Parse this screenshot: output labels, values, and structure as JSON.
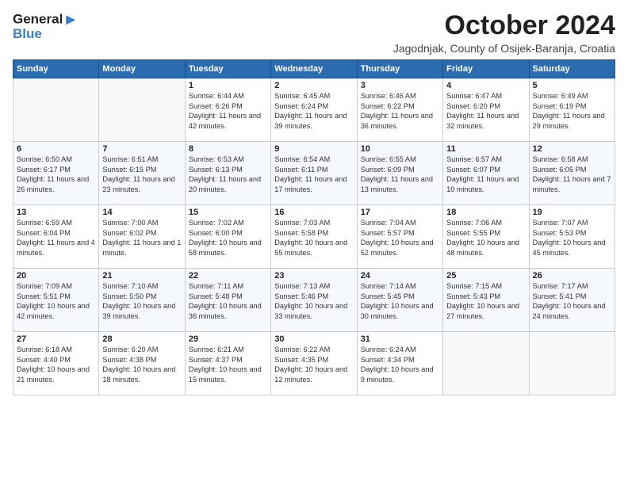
{
  "header": {
    "logo_line1": "General",
    "logo_line2": "Blue",
    "month": "October 2024",
    "location": "Jagodnjak, County of Osijek-Baranja, Croatia"
  },
  "weekdays": [
    "Sunday",
    "Monday",
    "Tuesday",
    "Wednesday",
    "Thursday",
    "Friday",
    "Saturday"
  ],
  "weeks": [
    [
      {
        "day": "",
        "info": ""
      },
      {
        "day": "",
        "info": ""
      },
      {
        "day": "1",
        "info": "Sunrise: 6:44 AM\nSunset: 6:26 PM\nDaylight: 11 hours and 42 minutes."
      },
      {
        "day": "2",
        "info": "Sunrise: 6:45 AM\nSunset: 6:24 PM\nDaylight: 11 hours and 39 minutes."
      },
      {
        "day": "3",
        "info": "Sunrise: 6:46 AM\nSunset: 6:22 PM\nDaylight: 11 hours and 36 minutes."
      },
      {
        "day": "4",
        "info": "Sunrise: 6:47 AM\nSunset: 6:20 PM\nDaylight: 11 hours and 32 minutes."
      },
      {
        "day": "5",
        "info": "Sunrise: 6:49 AM\nSunset: 6:19 PM\nDaylight: 11 hours and 29 minutes."
      }
    ],
    [
      {
        "day": "6",
        "info": "Sunrise: 6:50 AM\nSunset: 6:17 PM\nDaylight: 11 hours and 26 minutes."
      },
      {
        "day": "7",
        "info": "Sunrise: 6:51 AM\nSunset: 6:15 PM\nDaylight: 11 hours and 23 minutes."
      },
      {
        "day": "8",
        "info": "Sunrise: 6:53 AM\nSunset: 6:13 PM\nDaylight: 11 hours and 20 minutes."
      },
      {
        "day": "9",
        "info": "Sunrise: 6:54 AM\nSunset: 6:11 PM\nDaylight: 11 hours and 17 minutes."
      },
      {
        "day": "10",
        "info": "Sunrise: 6:55 AM\nSunset: 6:09 PM\nDaylight: 11 hours and 13 minutes."
      },
      {
        "day": "11",
        "info": "Sunrise: 6:57 AM\nSunset: 6:07 PM\nDaylight: 11 hours and 10 minutes."
      },
      {
        "day": "12",
        "info": "Sunrise: 6:58 AM\nSunset: 6:05 PM\nDaylight: 11 hours and 7 minutes."
      }
    ],
    [
      {
        "day": "13",
        "info": "Sunrise: 6:59 AM\nSunset: 6:04 PM\nDaylight: 11 hours and 4 minutes."
      },
      {
        "day": "14",
        "info": "Sunrise: 7:00 AM\nSunset: 6:02 PM\nDaylight: 11 hours and 1 minute."
      },
      {
        "day": "15",
        "info": "Sunrise: 7:02 AM\nSunset: 6:00 PM\nDaylight: 10 hours and 58 minutes."
      },
      {
        "day": "16",
        "info": "Sunrise: 7:03 AM\nSunset: 5:58 PM\nDaylight: 10 hours and 55 minutes."
      },
      {
        "day": "17",
        "info": "Sunrise: 7:04 AM\nSunset: 5:57 PM\nDaylight: 10 hours and 52 minutes."
      },
      {
        "day": "18",
        "info": "Sunrise: 7:06 AM\nSunset: 5:55 PM\nDaylight: 10 hours and 48 minutes."
      },
      {
        "day": "19",
        "info": "Sunrise: 7:07 AM\nSunset: 5:53 PM\nDaylight: 10 hours and 45 minutes."
      }
    ],
    [
      {
        "day": "20",
        "info": "Sunrise: 7:09 AM\nSunset: 5:51 PM\nDaylight: 10 hours and 42 minutes."
      },
      {
        "day": "21",
        "info": "Sunrise: 7:10 AM\nSunset: 5:50 PM\nDaylight: 10 hours and 39 minutes."
      },
      {
        "day": "22",
        "info": "Sunrise: 7:11 AM\nSunset: 5:48 PM\nDaylight: 10 hours and 36 minutes."
      },
      {
        "day": "23",
        "info": "Sunrise: 7:13 AM\nSunset: 5:46 PM\nDaylight: 10 hours and 33 minutes."
      },
      {
        "day": "24",
        "info": "Sunrise: 7:14 AM\nSunset: 5:45 PM\nDaylight: 10 hours and 30 minutes."
      },
      {
        "day": "25",
        "info": "Sunrise: 7:15 AM\nSunset: 5:43 PM\nDaylight: 10 hours and 27 minutes."
      },
      {
        "day": "26",
        "info": "Sunrise: 7:17 AM\nSunset: 5:41 PM\nDaylight: 10 hours and 24 minutes."
      }
    ],
    [
      {
        "day": "27",
        "info": "Sunrise: 6:18 AM\nSunset: 4:40 PM\nDaylight: 10 hours and 21 minutes."
      },
      {
        "day": "28",
        "info": "Sunrise: 6:20 AM\nSunset: 4:38 PM\nDaylight: 10 hours and 18 minutes."
      },
      {
        "day": "29",
        "info": "Sunrise: 6:21 AM\nSunset: 4:37 PM\nDaylight: 10 hours and 15 minutes."
      },
      {
        "day": "30",
        "info": "Sunrise: 6:22 AM\nSunset: 4:35 PM\nDaylight: 10 hours and 12 minutes."
      },
      {
        "day": "31",
        "info": "Sunrise: 6:24 AM\nSunset: 4:34 PM\nDaylight: 10 hours and 9 minutes."
      },
      {
        "day": "",
        "info": ""
      },
      {
        "day": "",
        "info": ""
      }
    ]
  ]
}
